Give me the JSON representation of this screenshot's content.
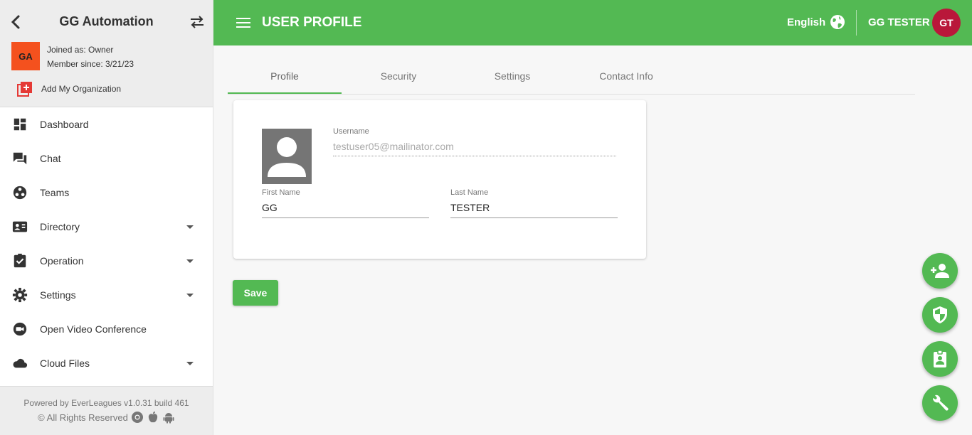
{
  "sidebar": {
    "org_title": "GG Automation",
    "org_initials": "GA",
    "joined_as": "Joined as: Owner",
    "member_since": "Member since: 3/21/23",
    "add_org_label": "Add My Organization",
    "items": [
      {
        "label": "Dashboard",
        "icon": "dashboard-icon",
        "has_caret": false
      },
      {
        "label": "Chat",
        "icon": "chat-icon",
        "has_caret": false
      },
      {
        "label": "Teams",
        "icon": "teams-icon",
        "has_caret": false
      },
      {
        "label": "Directory",
        "icon": "contact-card-icon",
        "has_caret": true
      },
      {
        "label": "Operation",
        "icon": "clipboard-check-icon",
        "has_caret": true
      },
      {
        "label": "Settings",
        "icon": "gear-icon",
        "has_caret": true
      },
      {
        "label": "Open Video Conference",
        "icon": "video-camera-icon",
        "has_caret": false
      },
      {
        "label": "Cloud Files",
        "icon": "cloud-icon",
        "has_caret": true
      }
    ],
    "footer": {
      "powered": "Powered by EverLeagues v1.0.31 build 461",
      "rights": "© All Rights Reserved"
    }
  },
  "topbar": {
    "title": "USER PROFILE",
    "language": "English",
    "user_name": "GG TESTER",
    "user_initials": "GT"
  },
  "tabs": [
    {
      "label": "Profile",
      "active": true
    },
    {
      "label": "Security",
      "active": false
    },
    {
      "label": "Settings",
      "active": false
    },
    {
      "label": "Contact Info",
      "active": false
    }
  ],
  "profile": {
    "username_label": "Username",
    "username_value": "testuser05@mailinator.com",
    "first_name_label": "First Name",
    "first_name_value": "GG",
    "last_name_label": "Last Name",
    "last_name_value": "TESTER"
  },
  "save_label": "Save",
  "colors": {
    "primary_green": "#53b953",
    "org_avatar": "#f4511e",
    "user_avatar": "#b9173a",
    "add_org_icon": "#e53935"
  },
  "fabs": [
    "add-user-icon",
    "shield-icon",
    "badge-icon",
    "wrench-icon"
  ]
}
